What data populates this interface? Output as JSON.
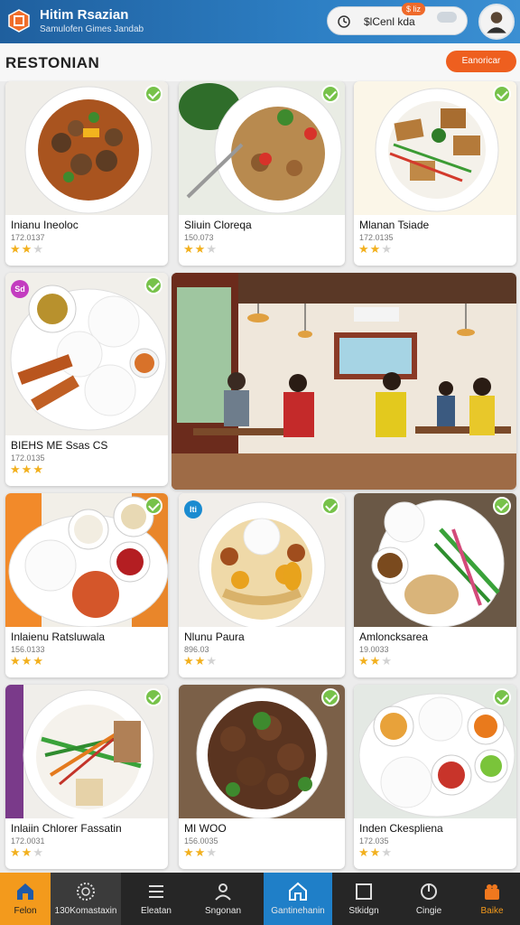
{
  "header": {
    "app_title": "Hitim Rsazian",
    "app_subtitle": "Samulofen Gimes Jandab",
    "search_text": "$lCenl kda",
    "notif_badge": "$ liz",
    "logo_icon": "hexagon-logo-icon",
    "avatar_icon": "user-avatar-icon"
  },
  "subheader": {
    "page_title": "RESTONIAN",
    "action_button": "Eanoricar"
  },
  "cards": [
    {
      "name": "Inianu Ineoloc",
      "code": "172.0137",
      "stars": 2
    },
    {
      "name": "Sliuin Cloreqa",
      "code": "150.073",
      "stars": 2
    },
    {
      "name": "Mlanan Tsiade",
      "code": "172.0135",
      "stars": 2
    },
    {
      "name": "BIEHS ME Ssas CS",
      "code": "172.0135",
      "stars": 3,
      "tag": "Sd"
    },
    {
      "name": "Inlaienu Ratsluwala",
      "code": "156.0133",
      "stars": 3
    },
    {
      "name": "Nlunu Paura",
      "code": "896.03",
      "stars": 2,
      "tag": "Iti"
    },
    {
      "name": "Amloncksarea",
      "code": "19.0033",
      "stars": 2
    },
    {
      "name": "Inlaiin Chlorer Fassatin",
      "code": "172.0031",
      "stars": 2
    },
    {
      "name": "MI WOO",
      "code": "156.0035",
      "stars": 2
    },
    {
      "name": "Inden Ckespliena",
      "code": "172.035",
      "stars": 2
    }
  ],
  "nav": [
    {
      "label": "Felon",
      "icon": "home-icon",
      "active": true
    },
    {
      "label": "130Komastaxin",
      "icon": "dial-icon"
    },
    {
      "label": "Eleatan",
      "icon": "list-icon"
    },
    {
      "label": "Sngonan",
      "icon": "profile-icon"
    },
    {
      "label": "Gantinehanin",
      "icon": "home-outline-icon",
      "highlight": true
    },
    {
      "label": "Stkidgn",
      "icon": "square-icon"
    },
    {
      "label": "Cingie",
      "icon": "circle-icon"
    },
    {
      "label": "Baike",
      "icon": "gift-icon"
    }
  ],
  "colors": {
    "header": "#2b78bf",
    "accent_orange": "#ee5f1f",
    "check_green": "#77c24a",
    "nav_bg": "#262626",
    "nav_active": "#f39a1c",
    "nav_highlight": "#1f7fc8",
    "star": "#f2b01e"
  }
}
